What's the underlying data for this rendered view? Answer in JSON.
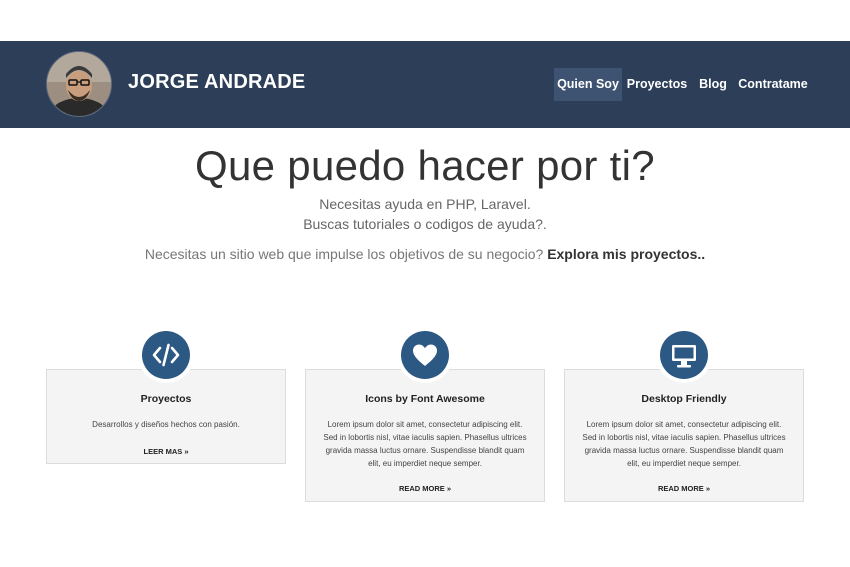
{
  "navbar": {
    "brand": "JORGE ANDRADE",
    "items": [
      {
        "label": "Quien Soy",
        "active": true
      },
      {
        "label": "Proyectos",
        "active": false
      },
      {
        "label": "Blog",
        "active": false
      },
      {
        "label": "Contratame",
        "active": false
      }
    ],
    "background_color": "#2c3e58",
    "active_color": "#3d5371"
  },
  "hero": {
    "title": "Que puedo hacer por ti?",
    "line1": "Necesitas ayuda en PHP, Laravel.",
    "line2": "Buscas tutoriales o codigos de ayuda?.",
    "cta_text": "Necesitas un sitio web que impulse los objetivos de su negocio? ",
    "cta_bold": "Explora mis proyectos.."
  },
  "cards": [
    {
      "icon": "code-icon",
      "title": "Proyectos",
      "text": "Desarrollos y diseños hechos con pasión.",
      "link": "LEER MAS »"
    },
    {
      "icon": "heart-icon",
      "title": "Icons by Font Awesome",
      "text": "Lorem ipsum dolor sit amet, consectetur adipiscing elit. Sed in lobortis nisl, vitae iaculis sapien. Phasellus ultrices gravida massa luctus ornare. Suspendisse blandit quam elit, eu imperdiet neque semper.",
      "link": "READ MORE »"
    },
    {
      "icon": "desktop-icon",
      "title": "Desktop Friendly",
      "text": "Lorem ipsum dolor sit amet, consectetur adipiscing elit. Sed in lobortis nisl, vitae iaculis sapien. Phasellus ultrices gravida massa luctus ornare. Suspendisse blandit quam elit, eu imperdiet neque semper.",
      "link": "READ MORE »"
    }
  ],
  "colors": {
    "accent": "#2c5984",
    "card_background": "#f4f4f4"
  }
}
